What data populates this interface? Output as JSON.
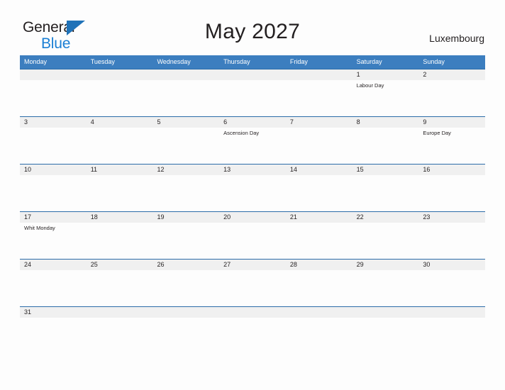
{
  "brand": {
    "name_part1": "General",
    "name_part2": "Blue",
    "flag_icon": "triangle-flag-icon",
    "accent_color": "#1f72b8",
    "text_blue": "#1a7fd4"
  },
  "header": {
    "title": "May 2027",
    "country": "Luxembourg"
  },
  "calendar": {
    "header_bg": "#3c7ebf",
    "row_border_color": "#2c6ca8",
    "number_band_color": "#f0f0f0",
    "weekdays": [
      "Monday",
      "Tuesday",
      "Wednesday",
      "Thursday",
      "Friday",
      "Saturday",
      "Sunday"
    ],
    "weeks": [
      [
        {
          "day": "",
          "event": ""
        },
        {
          "day": "",
          "event": ""
        },
        {
          "day": "",
          "event": ""
        },
        {
          "day": "",
          "event": ""
        },
        {
          "day": "",
          "event": ""
        },
        {
          "day": "1",
          "event": "Labour Day"
        },
        {
          "day": "2",
          "event": ""
        }
      ],
      [
        {
          "day": "3",
          "event": ""
        },
        {
          "day": "4",
          "event": ""
        },
        {
          "day": "5",
          "event": ""
        },
        {
          "day": "6",
          "event": "Ascension Day"
        },
        {
          "day": "7",
          "event": ""
        },
        {
          "day": "8",
          "event": ""
        },
        {
          "day": "9",
          "event": "Europe Day"
        }
      ],
      [
        {
          "day": "10",
          "event": ""
        },
        {
          "day": "11",
          "event": ""
        },
        {
          "day": "12",
          "event": ""
        },
        {
          "day": "13",
          "event": ""
        },
        {
          "day": "14",
          "event": ""
        },
        {
          "day": "15",
          "event": ""
        },
        {
          "day": "16",
          "event": ""
        }
      ],
      [
        {
          "day": "17",
          "event": "Whit Monday"
        },
        {
          "day": "18",
          "event": ""
        },
        {
          "day": "19",
          "event": ""
        },
        {
          "day": "20",
          "event": ""
        },
        {
          "day": "21",
          "event": ""
        },
        {
          "day": "22",
          "event": ""
        },
        {
          "day": "23",
          "event": ""
        }
      ],
      [
        {
          "day": "24",
          "event": ""
        },
        {
          "day": "25",
          "event": ""
        },
        {
          "day": "26",
          "event": ""
        },
        {
          "day": "27",
          "event": ""
        },
        {
          "day": "28",
          "event": ""
        },
        {
          "day": "29",
          "event": ""
        },
        {
          "day": "30",
          "event": ""
        }
      ],
      [
        {
          "day": "31",
          "event": ""
        },
        {
          "day": "",
          "event": ""
        },
        {
          "day": "",
          "event": ""
        },
        {
          "day": "",
          "event": ""
        },
        {
          "day": "",
          "event": ""
        },
        {
          "day": "",
          "event": ""
        },
        {
          "day": "",
          "event": ""
        }
      ]
    ]
  }
}
